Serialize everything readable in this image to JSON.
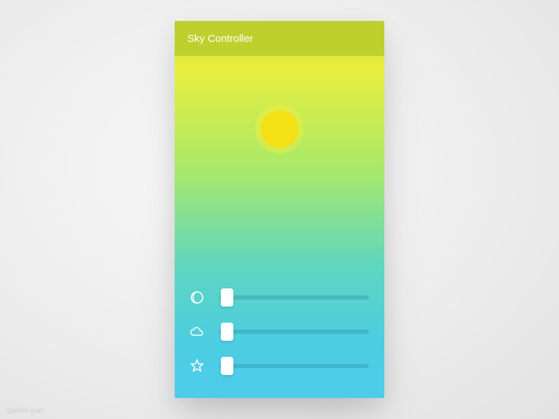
{
  "header": {
    "title": "Sky Controller"
  },
  "watermark": "galshir.com",
  "sliders": [
    {
      "icon": "moon-icon",
      "value": 0,
      "min": 0,
      "max": 100
    },
    {
      "icon": "cloud-icon",
      "value": 0,
      "min": 0,
      "max": 100
    },
    {
      "icon": "star-icon",
      "value": 0,
      "min": 0,
      "max": 100
    }
  ],
  "colors": {
    "header_bg": "#bdd02e",
    "sun": "#f5e016"
  }
}
